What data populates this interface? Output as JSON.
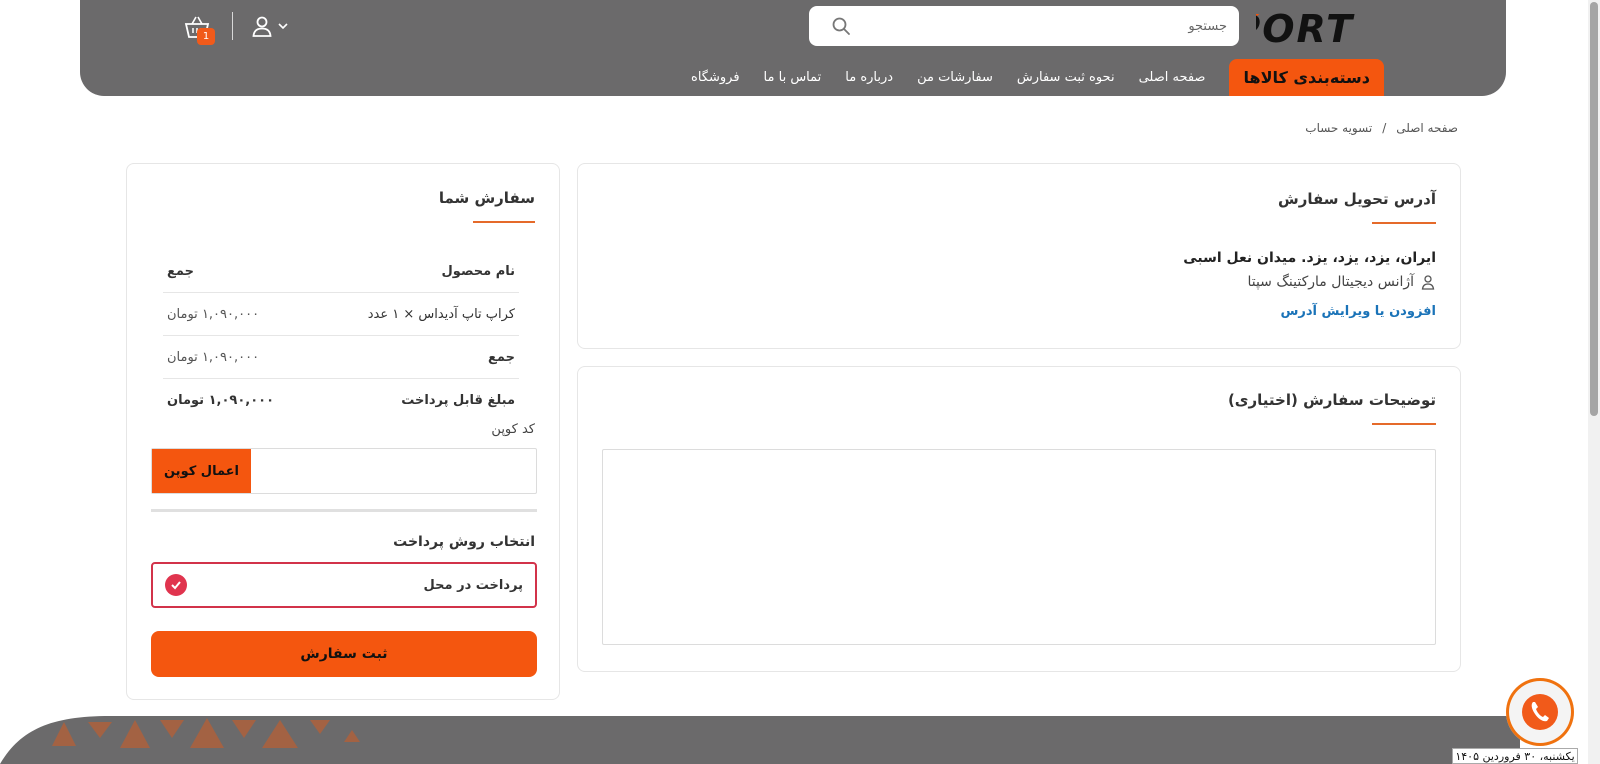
{
  "brand": {
    "logo_text": "TEKSPORT",
    "accent": "#f4560f",
    "header_bg": "#6b6a6b"
  },
  "search": {
    "placeholder": "جستجو"
  },
  "cart": {
    "count": "1"
  },
  "nav": {
    "category_button": "دسته‌بندی کالاها",
    "links": [
      "صفحه اصلی",
      "نحوه ثبت سفارش",
      "سفارشات من",
      "درباره ما",
      "تماس با ما",
      "فروشگاه"
    ]
  },
  "breadcrumb": {
    "home": "صفحه اصلی",
    "separator": "/",
    "current": "تسویه حساب"
  },
  "address": {
    "title": "آدرس تحویل سفارش",
    "line1": "ایران، یزد، یزد، یزد. میدان نعل اسبی",
    "recipient": "آژانس دیجیتال مارکتینگ سپتا",
    "edit_link": "افزودن یا ویرایش آدرس"
  },
  "notes": {
    "title": "توضیحات سفارش (اختیاری)"
  },
  "order": {
    "title": "سفارش شما",
    "header": {
      "product": "نام محصول",
      "total": "جمع"
    },
    "rows": [
      {
        "label": "کراپ تاپ آدیداس × ۱ عدد",
        "value": "۱,۰۹۰,۰۰۰ تومان"
      },
      {
        "label": "جمع",
        "value": "۱,۰۹۰,۰۰۰ تومان"
      },
      {
        "label": "مبلغ قابل پرداخت",
        "value": "۱,۰۹۰,۰۰۰  تومان"
      }
    ],
    "coupon_label": "کد کوپن",
    "coupon_button": "اعمال کوپن",
    "payment_title": "انتخاب روش پرداخت",
    "payment_option": "پرداخت در محل",
    "submit": "ثبت سفارش"
  },
  "footer": {
    "date": "یکشنبه، ۳۰ فروردین ۱۴۰۵"
  }
}
